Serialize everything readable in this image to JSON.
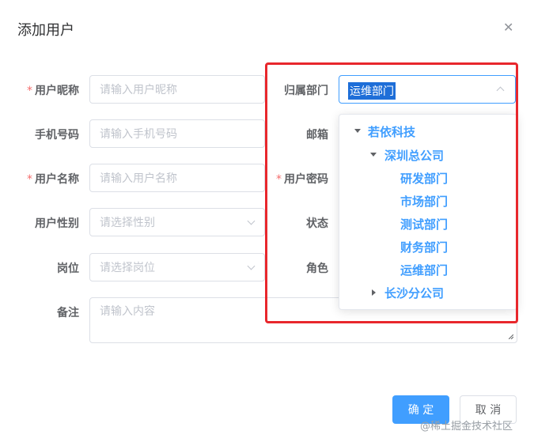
{
  "dialog": {
    "title": "添加用户",
    "close_icon": "close-icon"
  },
  "form": {
    "nickname": {
      "label": "用户昵称",
      "required": true,
      "placeholder": "请输入用户昵称"
    },
    "phone": {
      "label": "手机号码",
      "placeholder": "请输入手机号码"
    },
    "username": {
      "label": "用户名称",
      "required": true,
      "placeholder": "请输入用户名称"
    },
    "gender": {
      "label": "用户性别",
      "placeholder": "请选择性别"
    },
    "post": {
      "label": "岗位",
      "placeholder": "请选择岗位"
    },
    "remark": {
      "label": "备注",
      "placeholder": "请输入内容"
    },
    "dept": {
      "label": "归属部门",
      "value": "运维部门"
    },
    "email": {
      "label": "邮箱"
    },
    "password": {
      "label": "用户密码",
      "required": true
    },
    "status": {
      "label": "状态"
    },
    "role": {
      "label": "角色"
    }
  },
  "dept_tree": [
    {
      "label": "若依科技",
      "expanded": true
    },
    {
      "label": "深圳总公司",
      "expanded": true
    },
    {
      "label": "研发部门"
    },
    {
      "label": "市场部门"
    },
    {
      "label": "测试部门"
    },
    {
      "label": "财务部门"
    },
    {
      "label": "运维部门"
    },
    {
      "label": "长沙分公司",
      "expanded": false
    }
  ],
  "footer": {
    "confirm_label": "确 定",
    "cancel_label": "取 消"
  },
  "watermark": "@稀土掘金技术社区",
  "colors": {
    "primary": "#409eff",
    "required": "#f56c6c",
    "highlight_box": "#e8272c"
  }
}
